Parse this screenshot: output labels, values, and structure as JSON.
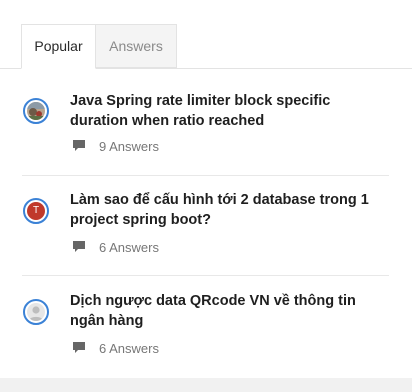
{
  "tabs": [
    {
      "label": "Popular",
      "active": true
    },
    {
      "label": "Answers",
      "active": false
    }
  ],
  "questions": [
    {
      "title": "Java Spring rate limiter block specific duration when ratio reached",
      "answers": "9 Answers",
      "avatar_type": "photo"
    },
    {
      "title": "Làm sao để cấu hình tới 2 database trong 1 project spring boot?",
      "answers": "6 Answers",
      "avatar_type": "initial",
      "avatar_initial": "T"
    },
    {
      "title": "Dịch ngược data QRcode VN về thông tin ngân hàng",
      "answers": "6 Answers",
      "avatar_type": "placeholder"
    }
  ],
  "colors": {
    "avatar_ring": "#3b82d6",
    "initial_avatar_bg": "#c0392b",
    "meta_text": "#777777"
  }
}
